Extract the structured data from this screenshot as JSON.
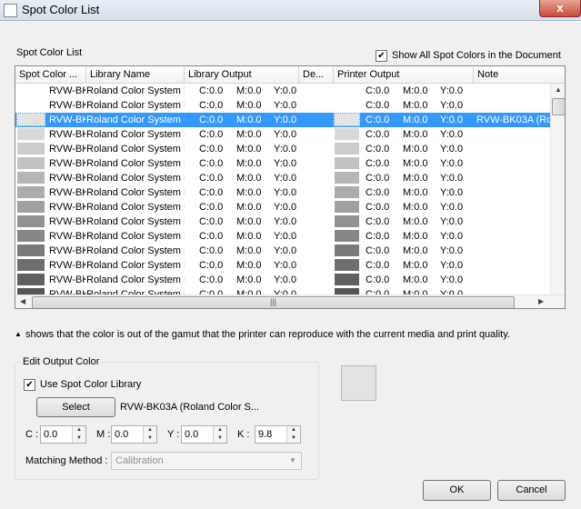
{
  "window": {
    "title": "Spot Color List",
    "close_label": "x"
  },
  "list_label": "Spot Color List",
  "show_all": {
    "label": "Show All Spot Colors in the Document",
    "checked": true
  },
  "columns": [
    {
      "key": "spot",
      "label": "Spot Color ..."
    },
    {
      "key": "library",
      "label": "Library Name"
    },
    {
      "key": "libout",
      "label": "Library Output"
    },
    {
      "key": "de",
      "label": "De..."
    },
    {
      "key": "printer",
      "label": "Printer Output"
    },
    {
      "key": "note",
      "label": "Note"
    }
  ],
  "rows": [
    {
      "name": "RVW-BK",
      "library": "Roland Color System L",
      "c": "C:0.0",
      "m": "M:0.0",
      "y": "Y:0.0",
      "pc": "C:0.0",
      "pm": "M:0.0",
      "py": "Y:0.0",
      "note": "",
      "color": "#ffffff",
      "selected": false
    },
    {
      "name": "RVW-BK",
      "library": "Roland Color System L",
      "c": "C:0.0",
      "m": "M:0.0",
      "y": "Y:0.0",
      "pc": "C:0.0",
      "pm": "M:0.0",
      "py": "Y:0.0",
      "note": "",
      "color": "#ffffff",
      "selected": false
    },
    {
      "name": "RVW-BK",
      "library": "Roland Color System L",
      "c": "C:0.0",
      "m": "M:0.0",
      "y": "Y:0.0",
      "pc": "C:0.0",
      "pm": "M:0.0",
      "py": "Y:0.0",
      "note": "RVW-BK03A (Ro",
      "color": "#e3e3e3",
      "selected": true
    },
    {
      "name": "RVW-BK",
      "library": "Roland Color System L",
      "c": "C:0.0",
      "m": "M:0.0",
      "y": "Y:0.0",
      "pc": "C:0.0",
      "pm": "M:0.0",
      "py": "Y:0.0",
      "note": "",
      "color": "#d8d8d8",
      "selected": false
    },
    {
      "name": "RVW-BK",
      "library": "Roland Color System L",
      "c": "C:0.0",
      "m": "M:0.0",
      "y": "Y:0.0",
      "pc": "C:0.0",
      "pm": "M:0.0",
      "py": "Y:0.0",
      "note": "",
      "color": "#cccccc",
      "selected": false
    },
    {
      "name": "RVW-BK",
      "library": "Roland Color System L",
      "c": "C:0.0",
      "m": "M:0.0",
      "y": "Y:0.0",
      "pc": "C:0.0",
      "pm": "M:0.0",
      "py": "Y:0.0",
      "note": "",
      "color": "#c2c2c2",
      "selected": false
    },
    {
      "name": "RVW-BK",
      "library": "Roland Color System L",
      "c": "C:0.0",
      "m": "M:0.0",
      "y": "Y:0.0",
      "pc": "C:0.0",
      "pm": "M:0.0",
      "py": "Y:0.0",
      "note": "",
      "color": "#b6b6b6",
      "selected": false
    },
    {
      "name": "RVW-BK",
      "library": "Roland Color System L",
      "c": "C:0.0",
      "m": "M:0.0",
      "y": "Y:0.0",
      "pc": "C:0.0",
      "pm": "M:0.0",
      "py": "Y:0.0",
      "note": "",
      "color": "#acacac",
      "selected": false
    },
    {
      "name": "RVW-BK",
      "library": "Roland Color System L",
      "c": "C:0.0",
      "m": "M:0.0",
      "y": "Y:0.0",
      "pc": "C:0.0",
      "pm": "M:0.0",
      "py": "Y:0.0",
      "note": "",
      "color": "#a0a0a0",
      "selected": false
    },
    {
      "name": "RVW-BK",
      "library": "Roland Color System L",
      "c": "C:0.0",
      "m": "M:0.0",
      "y": "Y:0.0",
      "pc": "C:0.0",
      "pm": "M:0.0",
      "py": "Y:0.0",
      "note": "",
      "color": "#939393",
      "selected": false
    },
    {
      "name": "RVW-BK",
      "library": "Roland Color System L",
      "c": "C:0.0",
      "m": "M:0.0",
      "y": "Y:0.0",
      "pc": "C:0.0",
      "pm": "M:0.0",
      "py": "Y:0.0",
      "note": "",
      "color": "#878787",
      "selected": false
    },
    {
      "name": "RVW-BK",
      "library": "Roland Color System L",
      "c": "C:0.0",
      "m": "M:0.0",
      "y": "Y:0.0",
      "pc": "C:0.0",
      "pm": "M:0.0",
      "py": "Y:0.0",
      "note": "",
      "color": "#7a7a7a",
      "selected": false
    },
    {
      "name": "RVW-BK",
      "library": "Roland Color System L",
      "c": "C:0.0",
      "m": "M:0.0",
      "y": "Y:0.0",
      "pc": "C:0.0",
      "pm": "M:0.0",
      "py": "Y:0.0",
      "note": "",
      "color": "#6e6e6e",
      "selected": false
    },
    {
      "name": "RVW-BK",
      "library": "Roland Color System L",
      "c": "C:0.0",
      "m": "M:0.0",
      "y": "Y:0.0",
      "pc": "C:0.0",
      "pm": "M:0.0",
      "py": "Y:0.0",
      "note": "",
      "color": "#606060",
      "selected": false
    },
    {
      "name": "RVW-BK",
      "library": "Roland Color System L",
      "c": "C:0.0",
      "m": "M:0.0",
      "y": "Y:0.0",
      "pc": "C:0.0",
      "pm": "M:0.0",
      "py": "Y:0.0",
      "note": "",
      "color": "#555555",
      "selected": false
    }
  ],
  "gamut_note": " shows that the color is out of the gamut that the printer can reproduce with the current media and print quality.",
  "edit": {
    "group_title": "Edit Output Color",
    "use_library_label": "Use Spot Color Library",
    "use_library_checked": true,
    "select_label": "Select",
    "selected_color": "RVW-BK03A (Roland Color S...",
    "c_label": "C :",
    "c_value": "0.0",
    "m_label": "M :",
    "m_value": "0.0",
    "y_label": "Y :",
    "y_value": "0.0",
    "k_label": "K :",
    "k_value": "9.8",
    "matching_label": "Matching Method :",
    "matching_value": "Calibration",
    "preview_color": "#e3e3e3"
  },
  "ok_label": "OK",
  "cancel_label": "Cancel"
}
